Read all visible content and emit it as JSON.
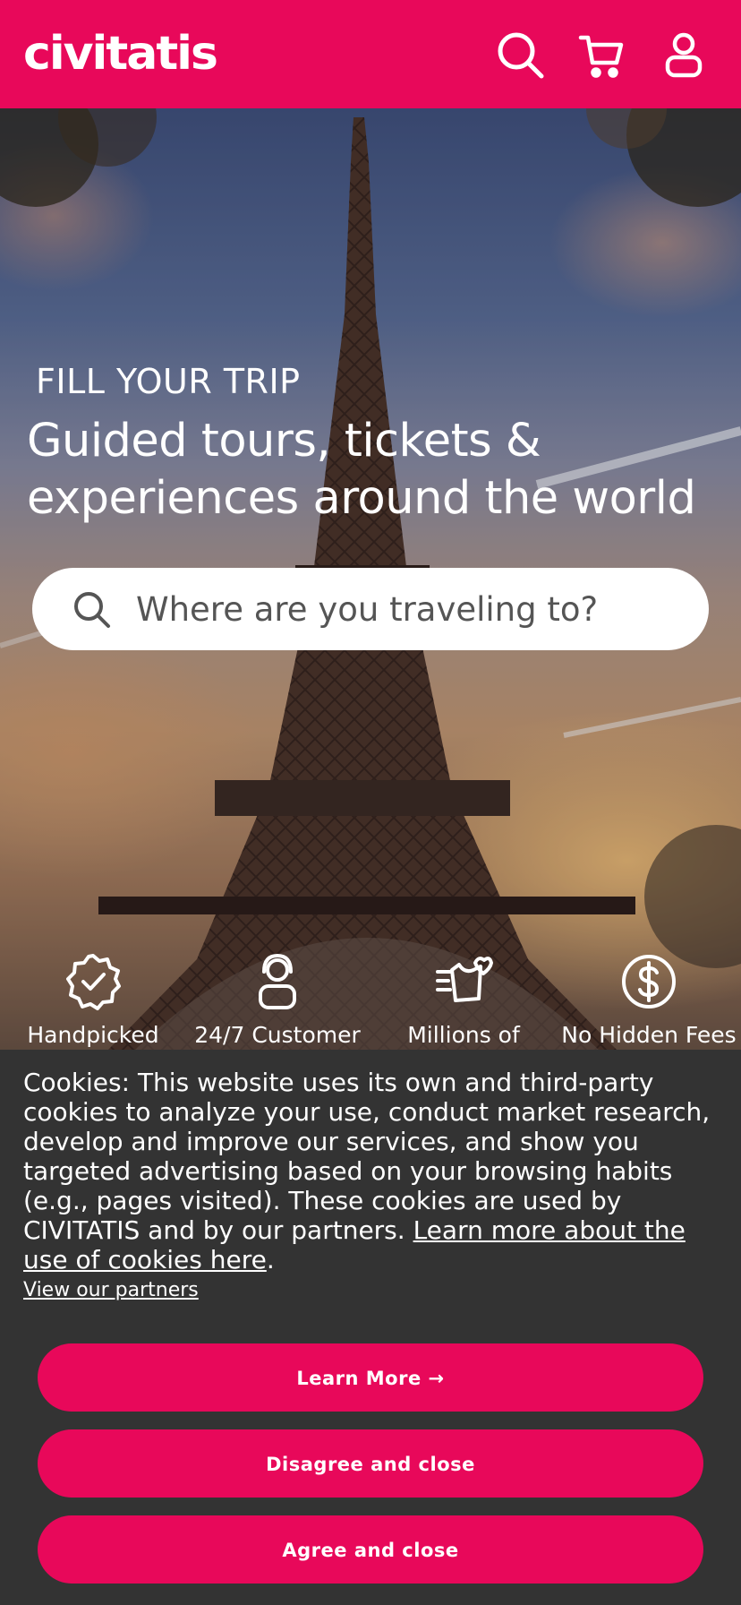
{
  "header": {
    "logo_text": "civitatis",
    "brand_color": "#e8085a",
    "icons": [
      "search-icon",
      "cart-icon",
      "user-icon"
    ]
  },
  "hero": {
    "eyebrow": "FILL YOUR TRIP",
    "headline": "Guided tours, tickets & experiences around the world",
    "search_placeholder": "Where are you traveling to?",
    "features": [
      {
        "icon": "verified-badge-icon",
        "label": "Handpicked"
      },
      {
        "icon": "customer-support-icon",
        "label": "24/7 Customer"
      },
      {
        "icon": "heart-reviews-icon",
        "label": "Millions of"
      },
      {
        "icon": "dollar-icon",
        "label": "No Hidden Fees"
      }
    ]
  },
  "cookies": {
    "text": "Cookies: This website uses its own and third-party cookies to analyze your use, conduct market research, develop and improve our services, and show you targeted advertising based on your browsing habits (e.g., pages visited). These cookies are used by CIVITATIS and by our partners. ",
    "learn_link": "Learn more about the use of cookies here",
    "period": ".",
    "partners_link": "View our partners",
    "buttons": {
      "learn_more": "Learn More →",
      "disagree": "Disagree and close",
      "agree": "Agree and close"
    },
    "panel_color": "#333333"
  }
}
